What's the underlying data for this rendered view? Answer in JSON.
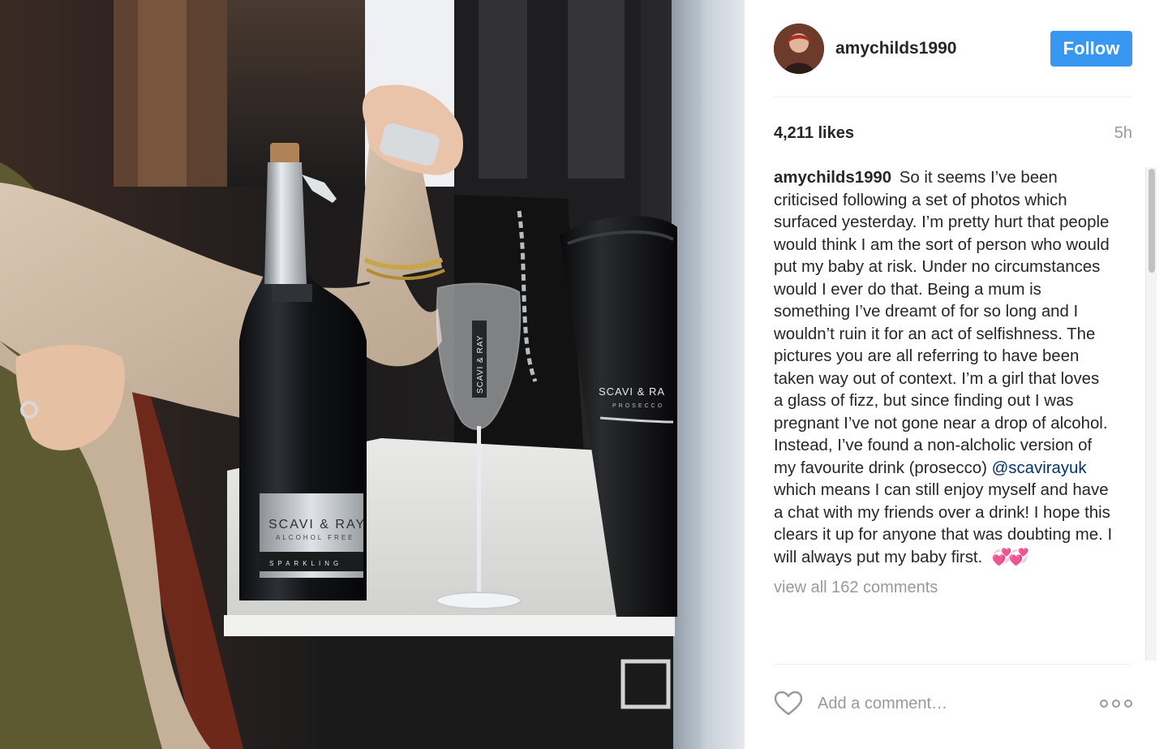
{
  "post": {
    "username": "amychilds1990",
    "follow_label": "Follow",
    "likes": "4,211 likes",
    "time": "5h",
    "caption_author": "amychilds1990",
    "caption_part1": "So it seems I’ve been criticised following a set of photos which surfaced yesterday. I’m pretty hurt that people would think I am the sort of person who would put my baby at risk. Under no circumstances would I ever do that. Being a mum is something I’ve dreamt of for so long and I wouldn’t ruin it for an act of selfishness. The pictures you are all referring to have been taken way out of context. I’m a girl that loves a glass of fizz, but since finding out I was pregnant I’ve not gone near a drop of alcohol. Instead, I’ve found a non-alcholic version of my favourite drink (prosecco)",
    "caption_mention": "@scavirayuk",
    "caption_part2": "which means I can still enjoy myself and have a chat with my friends over a drink! I hope this clears it up for anyone that was doubting me. I will always put my baby first.",
    "caption_emoji": "💞💞",
    "view_all_comments": "view all 162 comments",
    "comment_placeholder": "Add a comment…"
  },
  "photo": {
    "bottle_label_brand": "SCAVI & RAY",
    "bottle_label_sub": "ALCOHOL FREE",
    "bottle_label_bottom": "SPARKLING",
    "glass_label": "SCAVI & RAY",
    "bucket_label_brand": "SCAVI & RA",
    "bucket_label_sub": "PROSECCO"
  },
  "colors": {
    "follow_button": "#3897f0",
    "username_text": "#262626",
    "muted_text": "#999999",
    "mention_text": "#003569"
  },
  "icons": {
    "like": "heart-outline-icon",
    "more": "more-options-icon"
  }
}
